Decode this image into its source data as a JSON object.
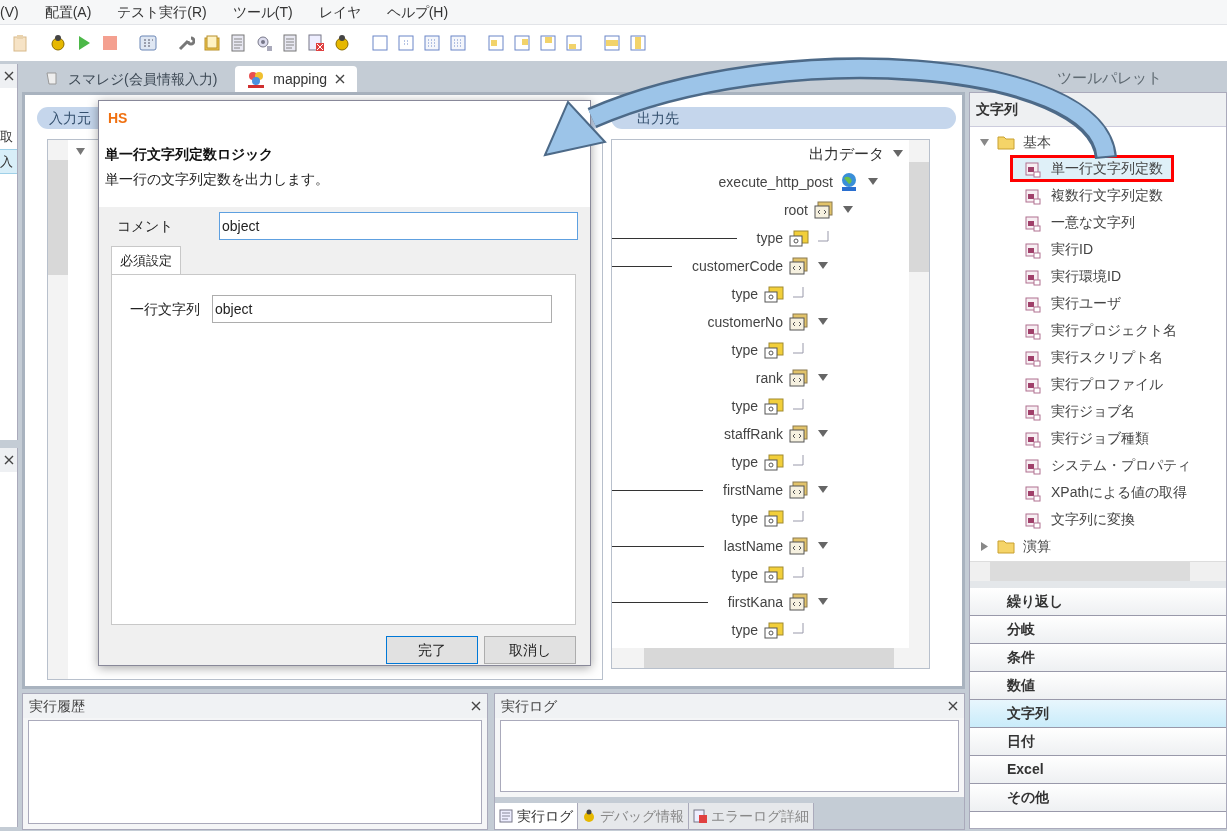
{
  "menu": [
    "(V)",
    "配置(A)",
    "テスト実行(R)",
    "ツール(T)",
    "レイヤ",
    "ヘルプ(H)"
  ],
  "left_panel": {
    "items": [
      {
        "label": "取",
        "selected": false
      },
      {
        "label": "入",
        "selected": true
      }
    ]
  },
  "editor_tabs": [
    {
      "label": "スマレジ(会員情報入力)",
      "selected": false,
      "kind": "script",
      "closable": false
    },
    {
      "label": "mapping",
      "selected": true,
      "kind": "mapping",
      "closable": true
    }
  ],
  "mapping": {
    "input_label": "入力元",
    "output_label": "出力先",
    "output_tree": {
      "label": "出力データ",
      "kind": "header",
      "expanded": true,
      "children": [
        {
          "label": "execute_http_post",
          "kind": "web",
          "expanded": true,
          "children": [
            {
              "label": "root",
              "kind": "object",
              "expanded": true,
              "children": [
                {
                  "label": "type",
                  "kind": "string",
                  "mapped": true
                },
                {
                  "label": "customerCode",
                  "kind": "object",
                  "mapped": true,
                  "expanded": true,
                  "children": [
                    {
                      "label": "type",
                      "kind": "string",
                      "mapped": false
                    }
                  ]
                },
                {
                  "label": "customerNo",
                  "kind": "object",
                  "mapped": false,
                  "expanded": true,
                  "children": [
                    {
                      "label": "type",
                      "kind": "string",
                      "mapped": false
                    }
                  ]
                },
                {
                  "label": "rank",
                  "kind": "object",
                  "mapped": false,
                  "expanded": true,
                  "children": [
                    {
                      "label": "type",
                      "kind": "string",
                      "mapped": false
                    }
                  ]
                },
                {
                  "label": "staffRank",
                  "kind": "object",
                  "mapped": false,
                  "expanded": true,
                  "children": [
                    {
                      "label": "type",
                      "kind": "string",
                      "mapped": false
                    }
                  ]
                },
                {
                  "label": "firstName",
                  "kind": "object",
                  "mapped": true,
                  "expanded": true,
                  "children": [
                    {
                      "label": "type",
                      "kind": "string",
                      "mapped": false
                    }
                  ]
                },
                {
                  "label": "lastName",
                  "kind": "object",
                  "mapped": true,
                  "expanded": true,
                  "children": [
                    {
                      "label": "type",
                      "kind": "string",
                      "mapped": false
                    }
                  ]
                },
                {
                  "label": "firstKana",
                  "kind": "object",
                  "mapped": true,
                  "expanded": true,
                  "children": [
                    {
                      "label": "type",
                      "kind": "string",
                      "mapped": false
                    }
                  ]
                }
              ]
            }
          ]
        }
      ]
    }
  },
  "dialog": {
    "title": "HS",
    "heading": "単一行文字列定数ロジック",
    "description": "単一行の文字列定数を出力します。",
    "comment_label": "コメント",
    "comment_value": "object",
    "tabs": [
      {
        "label": "必須設定",
        "selected": true
      }
    ],
    "field_label": "一行文字列",
    "field_value": "object",
    "buttons": [
      {
        "label": "完了",
        "default": true
      },
      {
        "label": "取消し",
        "default": false
      }
    ]
  },
  "palette": {
    "title": "ツールパレット",
    "section": "文字列",
    "folders": [
      {
        "label": "基本",
        "expanded": true,
        "children": [
          {
            "label": "単一行文字列定数",
            "selected": true,
            "highlighted": true
          },
          {
            "label": "複数行文字列定数",
            "selected": false,
            "highlighted": false
          },
          {
            "label": "一意な文字列",
            "selected": false,
            "highlighted": false
          },
          {
            "label": "実行ID",
            "selected": false,
            "highlighted": false
          },
          {
            "label": "実行環境ID",
            "selected": false,
            "highlighted": false
          },
          {
            "label": "実行ユーザ",
            "selected": false,
            "highlighted": false
          },
          {
            "label": "実行プロジェクト名",
            "selected": false,
            "highlighted": false
          },
          {
            "label": "実行スクリプト名",
            "selected": false,
            "highlighted": false
          },
          {
            "label": "実行プロファイル",
            "selected": false,
            "highlighted": false
          },
          {
            "label": "実行ジョブ名",
            "selected": false,
            "highlighted": false
          },
          {
            "label": "実行ジョブ種類",
            "selected": false,
            "highlighted": false
          },
          {
            "label": "システム・プロパティ",
            "selected": false,
            "highlighted": false
          },
          {
            "label": "XPathによる値の取得",
            "selected": false,
            "highlighted": false
          },
          {
            "label": "文字列に変換",
            "selected": false,
            "highlighted": false
          }
        ]
      },
      {
        "label": "演算",
        "expanded": false
      }
    ],
    "categories": [
      {
        "label": "繰り返し",
        "selected": false
      },
      {
        "label": "分岐",
        "selected": false
      },
      {
        "label": "条件",
        "selected": false
      },
      {
        "label": "数値",
        "selected": false
      },
      {
        "label": "文字列",
        "selected": true
      },
      {
        "label": "日付",
        "selected": false
      },
      {
        "label": "Excel",
        "selected": false
      },
      {
        "label": "その他",
        "selected": false
      }
    ]
  },
  "history_panel": {
    "title": "実行履歴"
  },
  "log_panel": {
    "title": "実行ログ",
    "tabs": [
      {
        "label": "実行ログ",
        "selected": true,
        "kind": "log"
      },
      {
        "label": "デバッグ情報",
        "selected": false,
        "kind": "debug"
      },
      {
        "label": "エラーログ詳細",
        "selected": false,
        "kind": "error"
      }
    ]
  }
}
